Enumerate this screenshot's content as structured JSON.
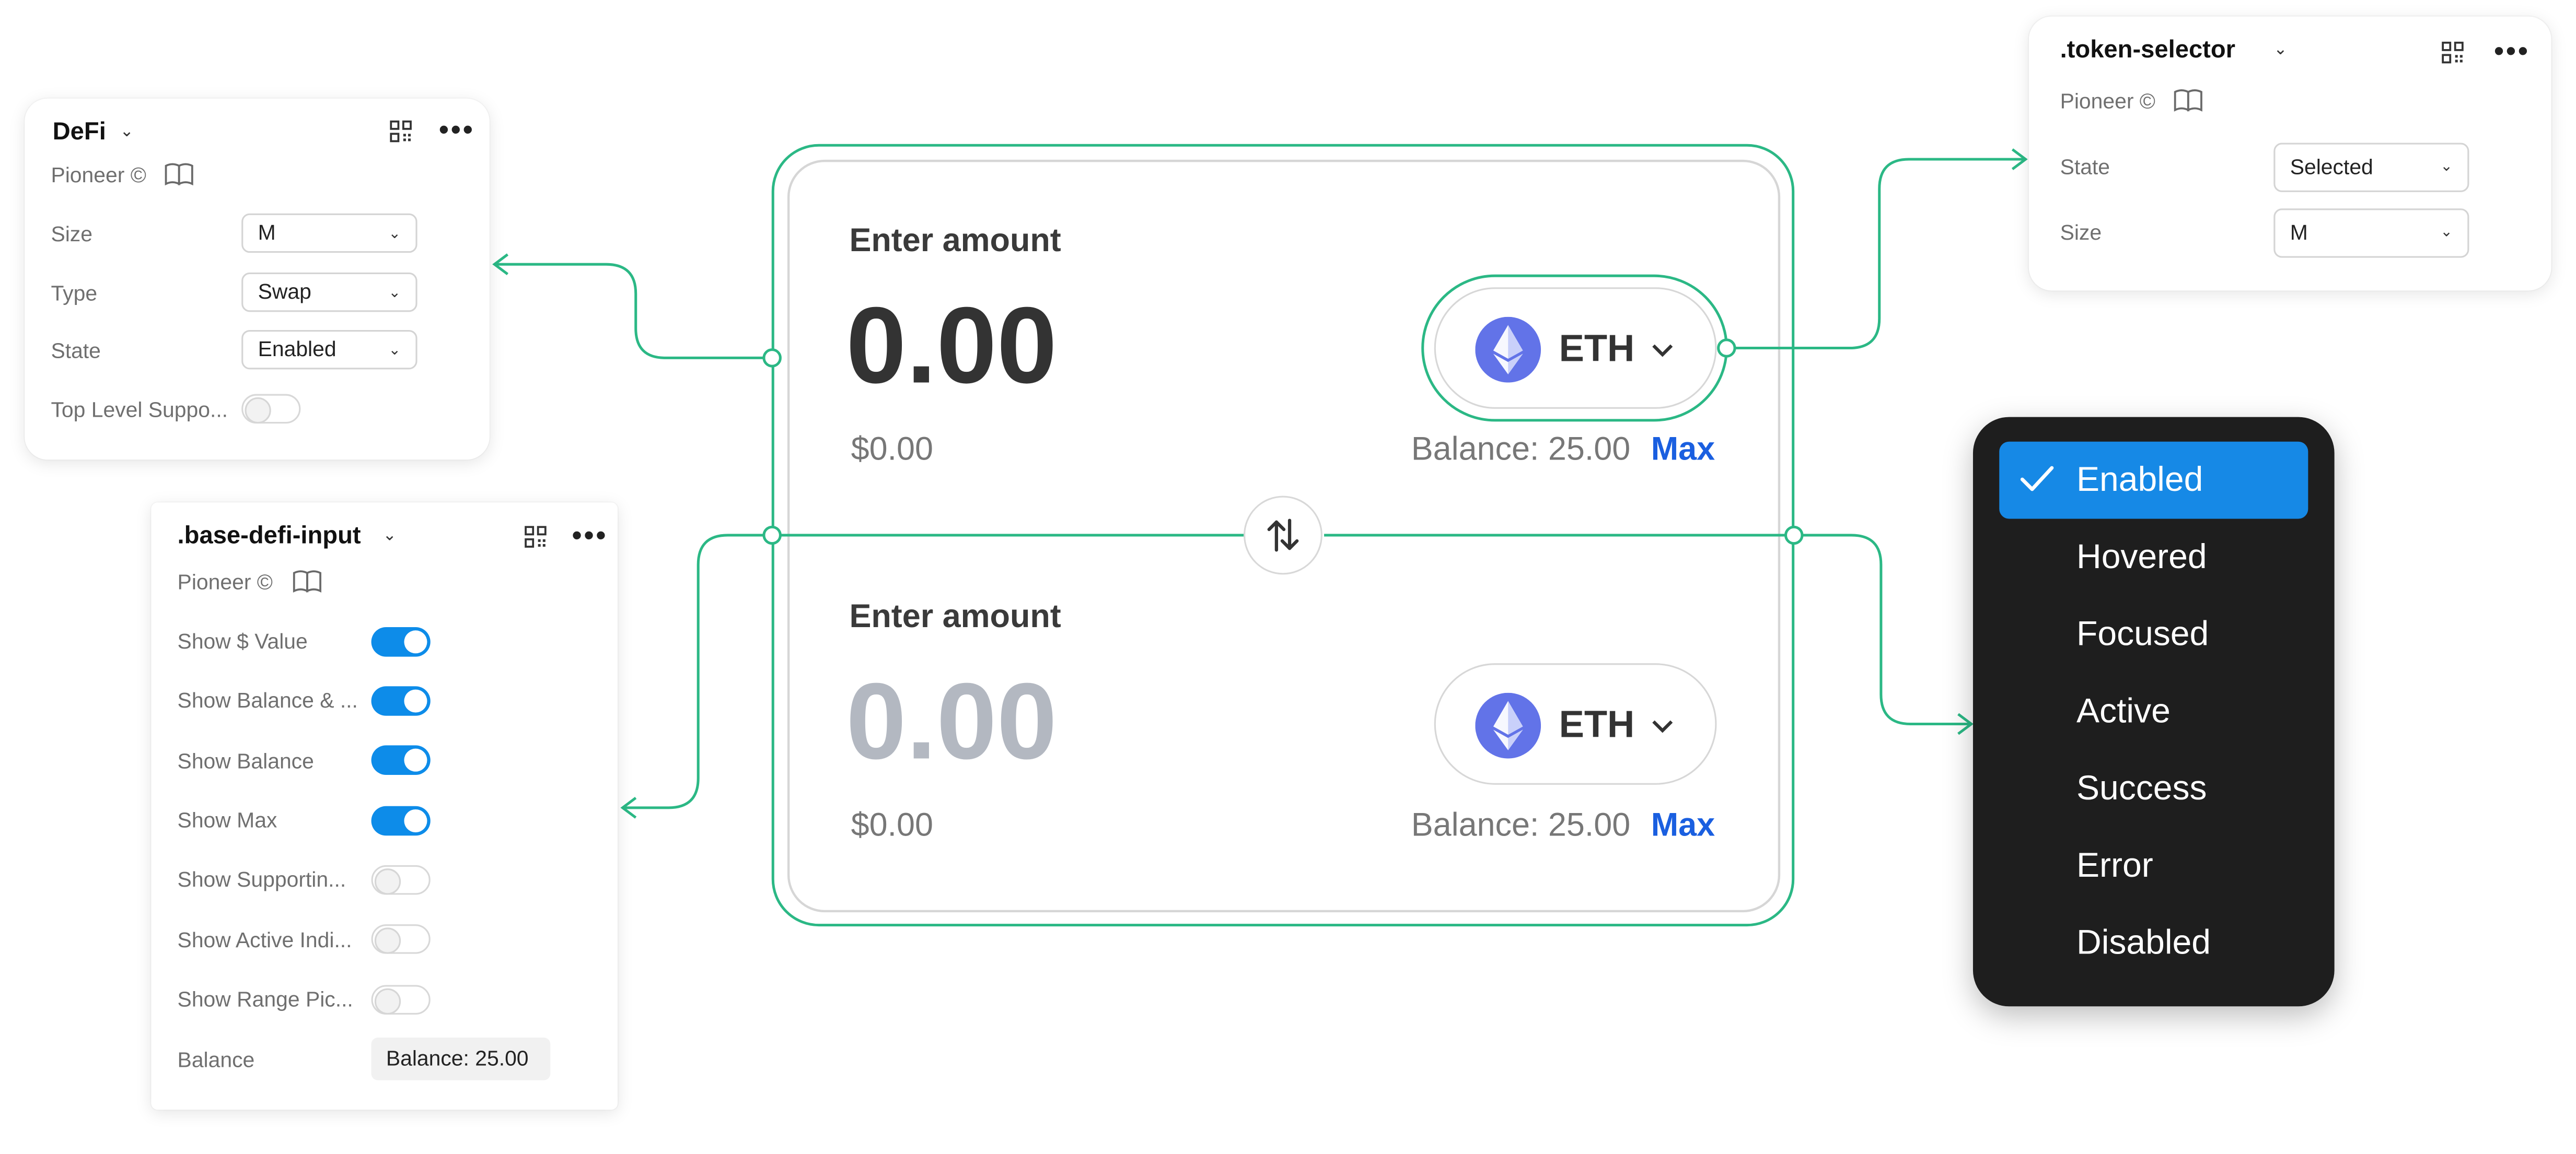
{
  "defi_panel": {
    "title": "DeFi",
    "library": "Pioneer ©",
    "props": [
      {
        "label": "Size",
        "value": "M"
      },
      {
        "label": "Type",
        "value": "Swap"
      },
      {
        "label": "State",
        "value": "Enabled"
      }
    ],
    "toggle_label": "Top Level Suppo...",
    "toggle_on": false
  },
  "base_defi_panel": {
    "title": ".base-defi-input",
    "library": "Pioneer ©",
    "toggles": [
      {
        "label": "Show $ Value",
        "on": true
      },
      {
        "label": "Show Balance & ...",
        "on": true
      },
      {
        "label": "Show Balance",
        "on": true
      },
      {
        "label": "Show Max",
        "on": true
      },
      {
        "label": "Show Supportin...",
        "on": false
      },
      {
        "label": "Show Active Indi...",
        "on": false
      },
      {
        "label": "Show Range Pic...",
        "on": false
      }
    ],
    "balance_label": "Balance",
    "balance_value": "Balance: 25.00"
  },
  "token_selector_panel": {
    "title": ".token-selector",
    "library": "Pioneer ©",
    "props": [
      {
        "label": "State",
        "value": "Selected"
      },
      {
        "label": "Size",
        "value": "M"
      }
    ]
  },
  "swap_card": {
    "top": {
      "heading": "Enter amount",
      "amount": "0.00",
      "usd": "$0.00",
      "token": "ETH",
      "balance": "Balance: 25.00",
      "max": "Max"
    },
    "bottom": {
      "heading": "Enter amount",
      "amount": "0.00",
      "usd": "$0.00",
      "token": "ETH",
      "balance": "Balance: 25.00",
      "max": "Max"
    }
  },
  "state_dropdown": {
    "options": [
      "Enabled",
      "Hovered",
      "Focused",
      "Active",
      "Success",
      "Error",
      "Disabled"
    ],
    "selected": "Enabled"
  },
  "colors": {
    "connector": "#2bb885",
    "accent_blue": "#1a5fe0",
    "toggle_on": "#0d8ce9",
    "dropdown_bg": "#1e1e1e",
    "dropdown_selected": "#1689e6",
    "eth_logo": "#6273e8",
    "amount_active": "#333333",
    "amount_placeholder": "#b3b8c1"
  },
  "icons": [
    "chevron-down-icon",
    "component-grid-icon",
    "more-dots-icon",
    "book-icon",
    "swap-arrows-icon",
    "eth-logo-icon",
    "checkmark-icon"
  ]
}
